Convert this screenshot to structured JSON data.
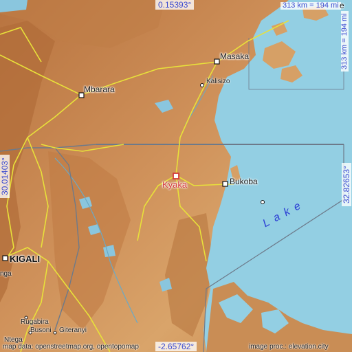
{
  "map": {
    "featured_place": "Kyaka",
    "cities": {
      "masaka": "Masaka",
      "mbarara": "Mbarara",
      "kalisizo": "Kalisizo",
      "bukoba": "Bukoba",
      "kigali": "KIGALI",
      "busoni": "Busoni",
      "giteranyi": "Giteranyi",
      "rugabira": "Rugabira",
      "ntega": "Ntega",
      "nga": "nga",
      "edge_e": "e"
    },
    "water_label": "L a k e",
    "coordinates": {
      "top": "0.15393°",
      "bottom": "-2.65762°",
      "left": "30.01403°",
      "right": "32.82653°"
    },
    "scale": {
      "horizontal": "313 km = 194 mi",
      "vertical": "313 km = 194 mi"
    },
    "credits": {
      "left": "map data: openstreetmap.org, opentopomap",
      "right": "image proc.: elevation.city"
    },
    "colors": {
      "water": "#93cfe3",
      "land_low": "#d9a46a",
      "land_high": "#b8733f",
      "road": "#e8e13a",
      "border": "#6d7a8a",
      "marker": "#d43a3a",
      "coord_text": "#3a4ad0"
    }
  }
}
